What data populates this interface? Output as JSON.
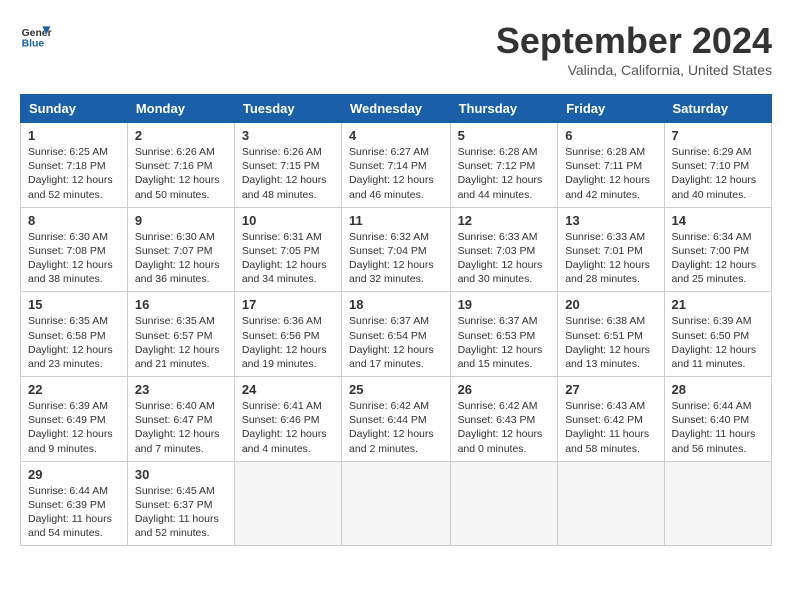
{
  "header": {
    "logo_line1": "General",
    "logo_line2": "Blue",
    "month": "September 2024",
    "location": "Valinda, California, United States"
  },
  "days_of_week": [
    "Sunday",
    "Monday",
    "Tuesday",
    "Wednesday",
    "Thursday",
    "Friday",
    "Saturday"
  ],
  "weeks": [
    [
      {
        "day": "1",
        "info": "Sunrise: 6:25 AM\nSunset: 7:18 PM\nDaylight: 12 hours\nand 52 minutes."
      },
      {
        "day": "2",
        "info": "Sunrise: 6:26 AM\nSunset: 7:16 PM\nDaylight: 12 hours\nand 50 minutes."
      },
      {
        "day": "3",
        "info": "Sunrise: 6:26 AM\nSunset: 7:15 PM\nDaylight: 12 hours\nand 48 minutes."
      },
      {
        "day": "4",
        "info": "Sunrise: 6:27 AM\nSunset: 7:14 PM\nDaylight: 12 hours\nand 46 minutes."
      },
      {
        "day": "5",
        "info": "Sunrise: 6:28 AM\nSunset: 7:12 PM\nDaylight: 12 hours\nand 44 minutes."
      },
      {
        "day": "6",
        "info": "Sunrise: 6:28 AM\nSunset: 7:11 PM\nDaylight: 12 hours\nand 42 minutes."
      },
      {
        "day": "7",
        "info": "Sunrise: 6:29 AM\nSunset: 7:10 PM\nDaylight: 12 hours\nand 40 minutes."
      }
    ],
    [
      {
        "day": "8",
        "info": "Sunrise: 6:30 AM\nSunset: 7:08 PM\nDaylight: 12 hours\nand 38 minutes."
      },
      {
        "day": "9",
        "info": "Sunrise: 6:30 AM\nSunset: 7:07 PM\nDaylight: 12 hours\nand 36 minutes."
      },
      {
        "day": "10",
        "info": "Sunrise: 6:31 AM\nSunset: 7:05 PM\nDaylight: 12 hours\nand 34 minutes."
      },
      {
        "day": "11",
        "info": "Sunrise: 6:32 AM\nSunset: 7:04 PM\nDaylight: 12 hours\nand 32 minutes."
      },
      {
        "day": "12",
        "info": "Sunrise: 6:33 AM\nSunset: 7:03 PM\nDaylight: 12 hours\nand 30 minutes."
      },
      {
        "day": "13",
        "info": "Sunrise: 6:33 AM\nSunset: 7:01 PM\nDaylight: 12 hours\nand 28 minutes."
      },
      {
        "day": "14",
        "info": "Sunrise: 6:34 AM\nSunset: 7:00 PM\nDaylight: 12 hours\nand 25 minutes."
      }
    ],
    [
      {
        "day": "15",
        "info": "Sunrise: 6:35 AM\nSunset: 6:58 PM\nDaylight: 12 hours\nand 23 minutes."
      },
      {
        "day": "16",
        "info": "Sunrise: 6:35 AM\nSunset: 6:57 PM\nDaylight: 12 hours\nand 21 minutes."
      },
      {
        "day": "17",
        "info": "Sunrise: 6:36 AM\nSunset: 6:56 PM\nDaylight: 12 hours\nand 19 minutes."
      },
      {
        "day": "18",
        "info": "Sunrise: 6:37 AM\nSunset: 6:54 PM\nDaylight: 12 hours\nand 17 minutes."
      },
      {
        "day": "19",
        "info": "Sunrise: 6:37 AM\nSunset: 6:53 PM\nDaylight: 12 hours\nand 15 minutes."
      },
      {
        "day": "20",
        "info": "Sunrise: 6:38 AM\nSunset: 6:51 PM\nDaylight: 12 hours\nand 13 minutes."
      },
      {
        "day": "21",
        "info": "Sunrise: 6:39 AM\nSunset: 6:50 PM\nDaylight: 12 hours\nand 11 minutes."
      }
    ],
    [
      {
        "day": "22",
        "info": "Sunrise: 6:39 AM\nSunset: 6:49 PM\nDaylight: 12 hours\nand 9 minutes."
      },
      {
        "day": "23",
        "info": "Sunrise: 6:40 AM\nSunset: 6:47 PM\nDaylight: 12 hours\nand 7 minutes."
      },
      {
        "day": "24",
        "info": "Sunrise: 6:41 AM\nSunset: 6:46 PM\nDaylight: 12 hours\nand 4 minutes."
      },
      {
        "day": "25",
        "info": "Sunrise: 6:42 AM\nSunset: 6:44 PM\nDaylight: 12 hours\nand 2 minutes."
      },
      {
        "day": "26",
        "info": "Sunrise: 6:42 AM\nSunset: 6:43 PM\nDaylight: 12 hours\nand 0 minutes."
      },
      {
        "day": "27",
        "info": "Sunrise: 6:43 AM\nSunset: 6:42 PM\nDaylight: 11 hours\nand 58 minutes."
      },
      {
        "day": "28",
        "info": "Sunrise: 6:44 AM\nSunset: 6:40 PM\nDaylight: 11 hours\nand 56 minutes."
      }
    ],
    [
      {
        "day": "29",
        "info": "Sunrise: 6:44 AM\nSunset: 6:39 PM\nDaylight: 11 hours\nand 54 minutes."
      },
      {
        "day": "30",
        "info": "Sunrise: 6:45 AM\nSunset: 6:37 PM\nDaylight: 11 hours\nand 52 minutes."
      },
      {
        "day": "",
        "info": ""
      },
      {
        "day": "",
        "info": ""
      },
      {
        "day": "",
        "info": ""
      },
      {
        "day": "",
        "info": ""
      },
      {
        "day": "",
        "info": ""
      }
    ]
  ]
}
